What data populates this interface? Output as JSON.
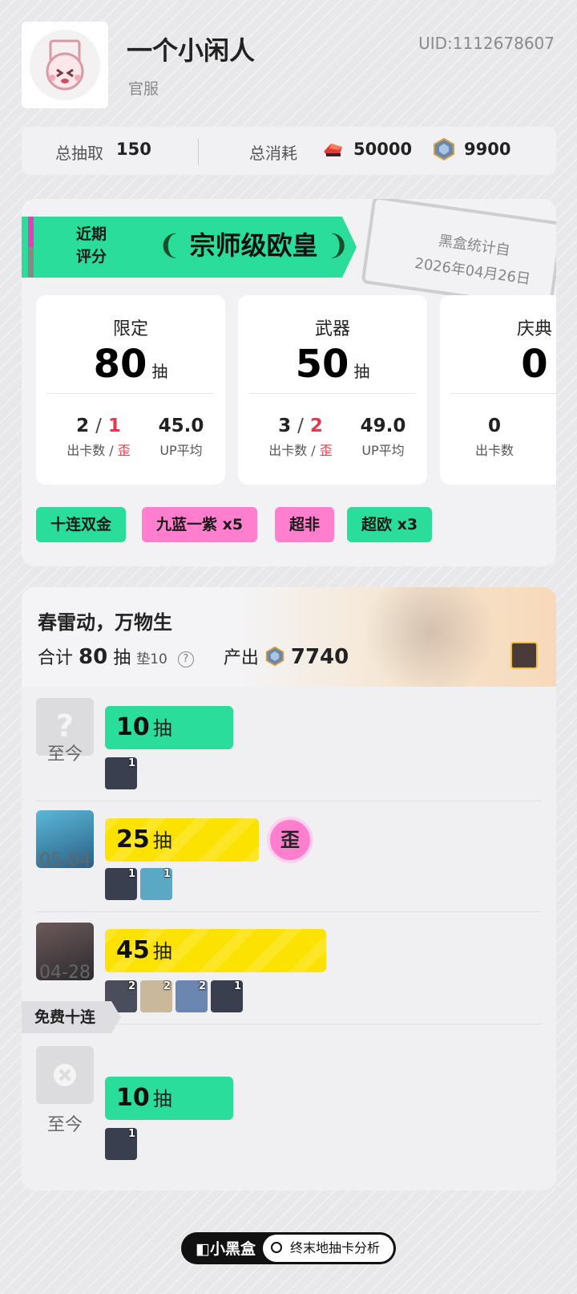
{
  "profile": {
    "name": "一个小闲人",
    "server": "官服",
    "uid": "UID:1112678607"
  },
  "totals": {
    "pulls_label": "总抽取",
    "pulls_value": "150",
    "cost_label": "总消耗",
    "cost_item1_value": "50000",
    "cost_item2_value": "9900"
  },
  "rating": {
    "recent_label_line1": "近期",
    "recent_label_line2": "评分",
    "title": "宗师级欧皇",
    "stamp_line1": "黑盒统计自",
    "stamp_line2": "2026年04月26日"
  },
  "pools": [
    {
      "name": "限定",
      "count": "80",
      "unit": "抽",
      "cards": "2",
      "off": "1",
      "sep": "/",
      "cards_label": "出卡数",
      "off_label": "歪",
      "avg": "45.0",
      "avg_label": "UP平均"
    },
    {
      "name": "武器",
      "count": "50",
      "unit": "抽",
      "cards": "3",
      "off": "2",
      "sep": "/",
      "cards_label": "出卡数",
      "off_label": "歪",
      "avg": "49.0",
      "avg_label": "UP平均"
    },
    {
      "name": "庆典",
      "count": "0",
      "cards": "0",
      "cards_label": "出卡数"
    }
  ],
  "tags": [
    "十连双金",
    "九蓝一紫 x5",
    "超非",
    "超欧 x3"
  ],
  "banner": {
    "name": "春雷动，万物生",
    "sum_prefix": "合计",
    "sum_value": "80",
    "sum_unit": "抽",
    "pity": "垫10",
    "help": "?",
    "output_label": "产出",
    "output_value": "7740"
  },
  "rows": [
    {
      "date": "至今",
      "pulls": "10",
      "unit": "抽",
      "minis": [
        "1"
      ]
    },
    {
      "date": "05-04",
      "pulls": "25",
      "unit": "抽",
      "badge": "歪",
      "minis": [
        "1",
        "1"
      ]
    },
    {
      "date": "04-28",
      "pulls": "45",
      "unit": "抽",
      "minis": [
        "2",
        "2",
        "2",
        "1"
      ]
    },
    {
      "date": "至今",
      "pulls": "10",
      "unit": "抽",
      "minis": [
        "1"
      ]
    }
  ],
  "free_label": "免费十连",
  "footer": {
    "brand": "小黑盒",
    "search_text": "终末地抽卡分析"
  },
  "colors": {
    "accent_green": "#2bdd9a",
    "accent_yellow": "#fbe200",
    "accent_pink": "#ff7fce",
    "off_red": "#e8364a"
  }
}
